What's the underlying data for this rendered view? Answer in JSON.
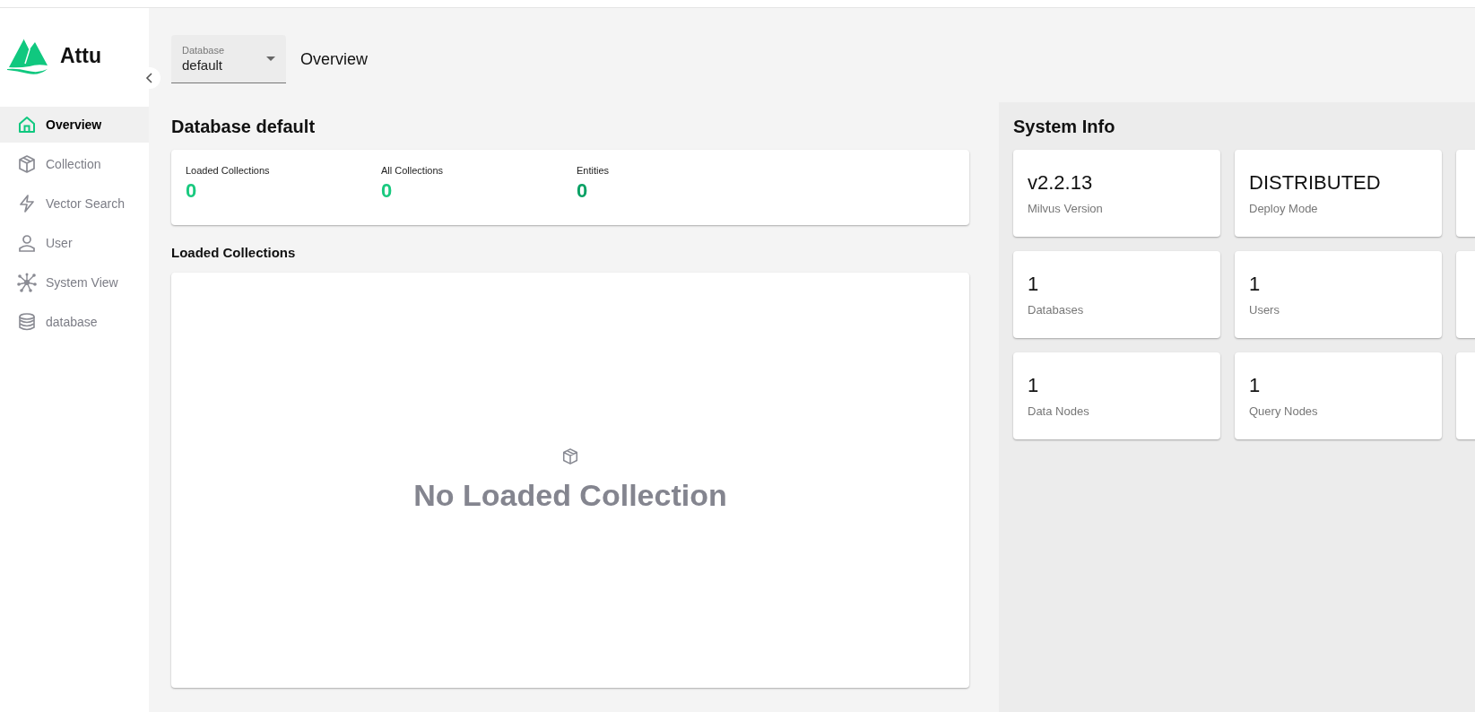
{
  "sidebar": {
    "logo": "Attu",
    "items": [
      {
        "label": "Overview",
        "selected": true
      },
      {
        "label": "Collection",
        "selected": false
      },
      {
        "label": "Vector Search",
        "selected": false
      },
      {
        "label": "User",
        "selected": false
      },
      {
        "label": "System View",
        "selected": false
      },
      {
        "label": "database",
        "selected": false
      }
    ]
  },
  "header": {
    "database_select": {
      "label": "Database",
      "value": "default"
    },
    "title": "Overview"
  },
  "database_panel": {
    "title": "Database default",
    "stats": [
      {
        "label": "Loaded Collections",
        "value": "0",
        "color": "#19c97f"
      },
      {
        "label": "All Collections",
        "value": "0",
        "color": "#19c97f"
      },
      {
        "label": "Entities",
        "value": "0",
        "color": "#0aa165"
      }
    ],
    "loaded_title": "Loaded Collections",
    "empty_message": "No Loaded Collection"
  },
  "system_info": {
    "title": "System Info",
    "cards": [
      {
        "value": "v2.2.13",
        "label": "Milvus Version"
      },
      {
        "value": "DISTRIBUTED",
        "label": "Deploy Mode"
      },
      {
        "value": "1",
        "label": "Databases"
      },
      {
        "value": "1",
        "label": "Users"
      },
      {
        "value": "1",
        "label": "Data Nodes"
      },
      {
        "value": "1",
        "label": "Query Nodes"
      }
    ]
  }
}
